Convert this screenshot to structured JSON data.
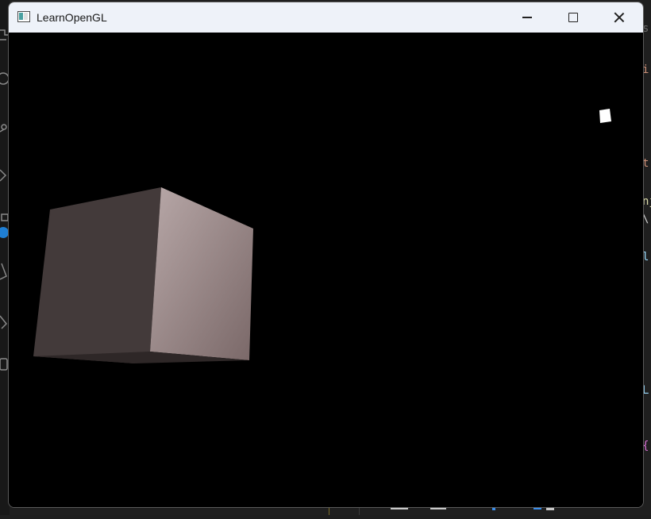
{
  "window": {
    "title": "LearnOpenGL",
    "controls": {
      "minimize_icon": "minimize-icon",
      "maximize_icon": "maximize-icon",
      "close_icon": "close-icon"
    }
  },
  "scene": {
    "background_color": "#000000",
    "cube_colors": {
      "left_face": "#433a3a",
      "right_face_light": "#b8a8a8",
      "right_face_dark": "#7a6868",
      "bottom_edge": "#2e2727"
    },
    "light_cube_color": "#ffffff"
  },
  "background_editor": {
    "right_fragments": [
      {
        "text": "s",
        "color": "#6a6a6a"
      },
      {
        "text": "i",
        "color": "#ce9178"
      },
      {
        "text": "t",
        "color": "#ce9178"
      },
      {
        "text": "nj",
        "color": "#dcdcaa"
      },
      {
        "text": "\\",
        "color": "#d4d4d4"
      },
      {
        "text": "l",
        "color": "#9cdcfe"
      },
      {
        "text": "L",
        "color": "#9cdcfe"
      },
      {
        "text": "{",
        "color": "#da70d6"
      }
    ]
  }
}
